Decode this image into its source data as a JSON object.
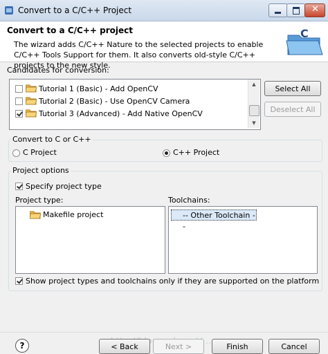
{
  "window": {
    "title": "Convert to a C/C++ Project"
  },
  "header": {
    "title": "Convert to a C/C++ project",
    "description": "The wizard adds C/C++ Nature to the selected projects to enable C/C++ Tools Support for them. It also converts old-style C/C++ projects to the new style."
  },
  "candidates": {
    "label": "Candidates for conversion:",
    "items": [
      {
        "label": "Tutorial 1 (Basic) - Add OpenCV",
        "checked": false
      },
      {
        "label": "Tutorial 2 (Basic) - Use OpenCV Camera",
        "checked": false
      },
      {
        "label": "Tutorial 3 (Advanced) - Add Native OpenCV",
        "checked": true
      }
    ],
    "select_all": "Select All",
    "deselect_all": "Deselect All"
  },
  "convert": {
    "label": "Convert to C or C++",
    "c_project": "C Project",
    "cpp_project": "C++ Project",
    "selected": "cpp"
  },
  "options": {
    "label": "Project options",
    "specify_type": "Specify project type",
    "project_type_label": "Project type:",
    "project_types": [
      "Makefile project"
    ],
    "toolchains_label": "Toolchains:",
    "toolchains": [
      "-- Other Toolchain --"
    ],
    "show_supported": "Show project types and toolchains only if they are supported on the platform"
  },
  "footer": {
    "help": "?",
    "back": "< Back",
    "next": "Next >",
    "finish": "Finish",
    "cancel": "Cancel"
  },
  "watermark": "http://blog.csdn.net/..."
}
